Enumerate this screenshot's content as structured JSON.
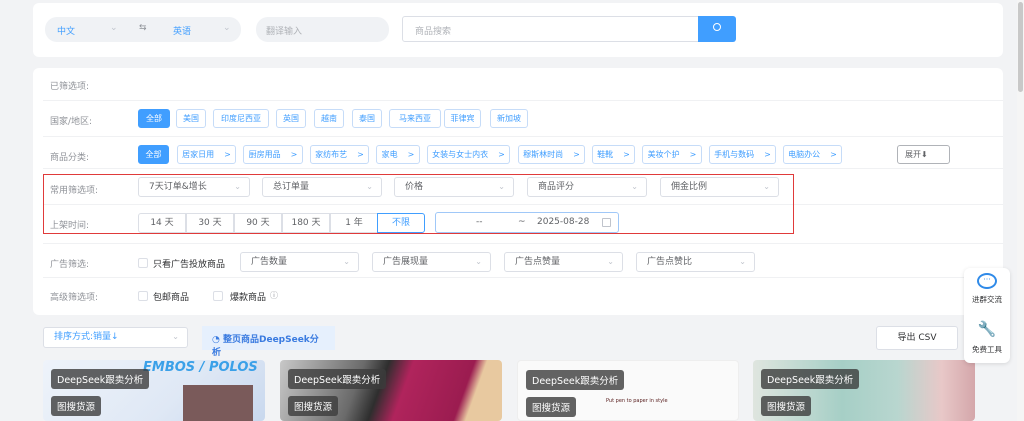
{
  "translate": {
    "source_lang": "中文",
    "swap_icon": "⇆",
    "target_lang": "英语",
    "translate_placeholder": "翻译输入",
    "search_placeholder": "商品搜索"
  },
  "filters": {
    "selected_label": "已筛选项:",
    "country_label": "国家/地区:",
    "countries": [
      "全部",
      "美国",
      "印度尼西亚",
      "英国",
      "越南",
      "泰国",
      "马来西亚",
      "菲律宾",
      "新加坡"
    ],
    "category_label": "商品分类:",
    "categories": [
      "全部",
      "居家日用",
      "厨房用品",
      "家纺布艺",
      "家电",
      "女装与女士内衣",
      "穆斯林时尚",
      "鞋靴",
      "美妆个护",
      "手机与数码",
      "电脑办公"
    ],
    "expand_label": "展开⬇",
    "common_label": "常用筛选项:",
    "common_selects": [
      "7天订单&增长",
      "总订单量",
      "价格",
      "商品评分",
      "佣金比例"
    ],
    "listing_label": "上架时间:",
    "time_options": [
      "14 天",
      "30 天",
      "90 天",
      "180 天",
      "1 年",
      "不限"
    ],
    "date_start": "--",
    "date_sep": "~",
    "date_end": "2025-08-28",
    "ad_label": "广告筛选:",
    "ad_only": "只看广告投放商品",
    "ad_selects": [
      "广告数量",
      "广告展现量",
      "广告点赞量",
      "广告点赞比"
    ],
    "advanced_label": "高级筛选项:",
    "free_shipping": "包邮商品",
    "hot_items": "爆款商品"
  },
  "toolbar": {
    "sort": "排序方式:销量↓",
    "deepseek_page": "整页商品DeepSeek分析",
    "export": "导出 CSV"
  },
  "products": [
    {
      "analysis": "DeepSeek跟卖分析",
      "source": "图搜货源",
      "image_text": "EMBOS / POLOS"
    },
    {
      "analysis": "DeepSeek跟卖分析",
      "source": "图搜货源"
    },
    {
      "analysis": "DeepSeek跟卖分析",
      "source": "图搜货源",
      "image_text": "Put pen to paper in style"
    },
    {
      "analysis": "DeepSeek跟卖分析",
      "source": "图搜货源"
    }
  ],
  "float": {
    "chat": "进群交流",
    "tools": "免费工具"
  },
  "colors": {
    "primary": "#409eff",
    "highlight": "#e03a3a"
  }
}
